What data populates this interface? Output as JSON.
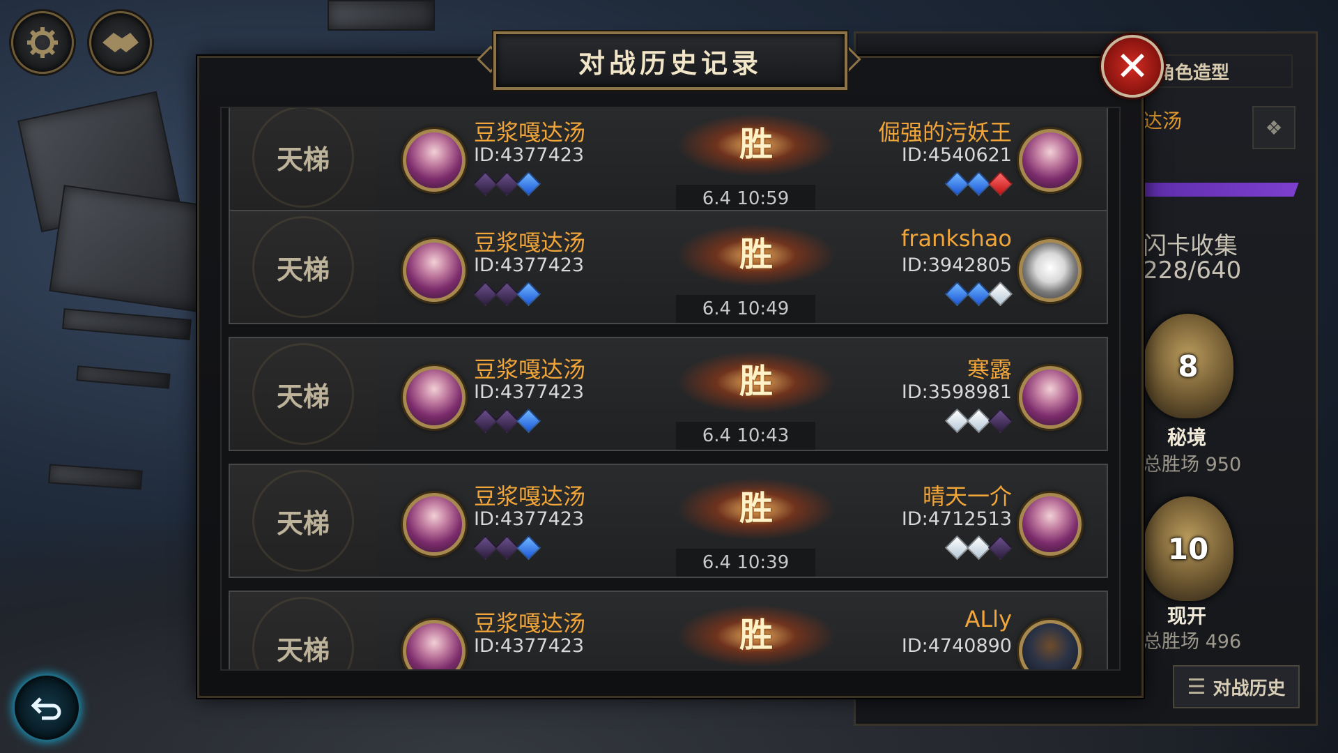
{
  "header": {
    "title": "对战历史记录"
  },
  "right_panel": {
    "tab_label": "角色造型",
    "player_name_partial": "达汤",
    "card_collection_label": "闪卡收集",
    "card_collection_value": "228/640",
    "modes": [
      {
        "badge_num": "8",
        "title": "秘境",
        "wins_label": "总胜场",
        "wins": "950"
      },
      {
        "badge_num": "10",
        "title": "现开",
        "wins_label": "总胜场",
        "wins": "496"
      }
    ],
    "history_button": "对战历史"
  },
  "matches": [
    {
      "type": "天梯",
      "p1_name": "豆浆嘎达汤",
      "p1_id": "ID:4377423",
      "p1_gems": [
        "purple",
        "purple",
        "blue"
      ],
      "result": "胜",
      "time": "6.4  10:59",
      "p2_name": "倔强的污妖王",
      "p2_id": "ID:4540621",
      "p2_gems": [
        "blue",
        "blue",
        "red"
      ],
      "p2_avatar": "elf"
    },
    {
      "type": "天梯",
      "p1_name": "豆浆嘎达汤",
      "p1_id": "ID:4377423",
      "p1_gems": [
        "purple",
        "purple",
        "blue"
      ],
      "result": "胜",
      "time": "6.4  10:49",
      "p2_name": "frankshao",
      "p2_id": "ID:3942805",
      "p2_gems": [
        "blue",
        "blue",
        "white"
      ],
      "p2_avatar": "hood"
    },
    {
      "type": "天梯",
      "p1_name": "豆浆嘎达汤",
      "p1_id": "ID:4377423",
      "p1_gems": [
        "purple",
        "purple",
        "blue"
      ],
      "result": "胜",
      "time": "6.4  10:43",
      "p2_name": "寒露",
      "p2_id": "ID:3598981",
      "p2_gems": [
        "white",
        "white",
        "purple"
      ],
      "p2_avatar": "elf"
    },
    {
      "type": "天梯",
      "p1_name": "豆浆嘎达汤",
      "p1_id": "ID:4377423",
      "p1_gems": [
        "purple",
        "purple",
        "blue"
      ],
      "result": "胜",
      "time": "6.4  10:39",
      "p2_name": "晴天一介",
      "p2_id": "ID:4712513",
      "p2_gems": [
        "white",
        "white",
        "purple"
      ],
      "p2_avatar": "elf"
    },
    {
      "type": "天梯",
      "p1_name": "豆浆嘎达汤",
      "p1_id": "ID:4377423",
      "p1_gems": [],
      "result": "胜",
      "time": "",
      "p2_name": "ALly",
      "p2_id": "ID:4740890",
      "p2_gems": [],
      "p2_avatar": "dark"
    }
  ],
  "icons": {
    "settings": "gear-icon",
    "social": "handshake-icon",
    "back": "back-arrow-icon",
    "close": "close-icon"
  }
}
